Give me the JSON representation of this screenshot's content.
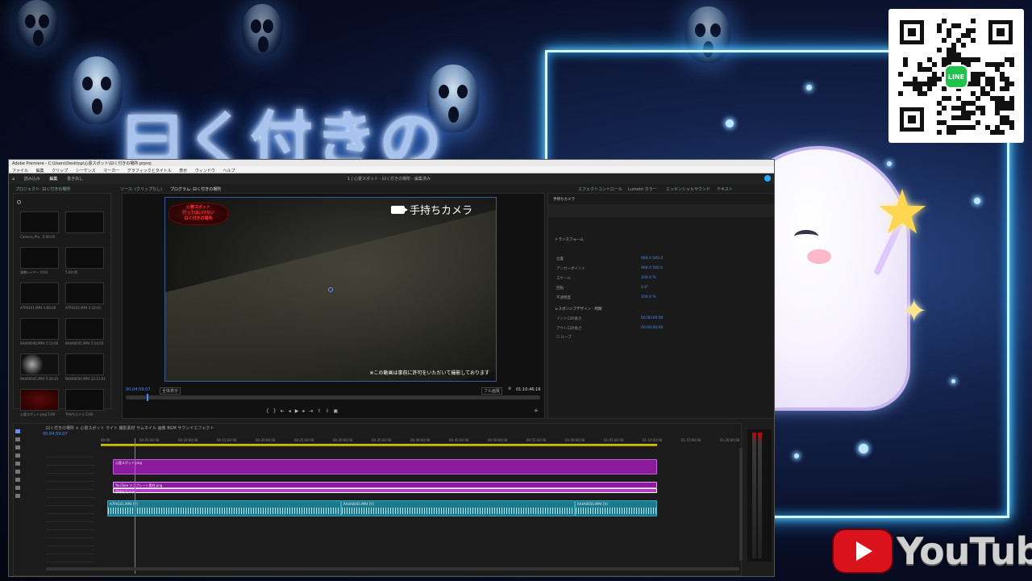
{
  "background": {
    "title": "曰く付きの",
    "accent": "#2aa9ff",
    "youtube_label": "YouTube",
    "line_label": "LINE"
  },
  "app": {
    "title": "Adobe Premiere - C:\\Users\\Desktop\\心霊スポット\\曰く付きの場所.prproj",
    "menu": [
      "ファイル",
      "編集",
      "クリップ",
      "シーケンス",
      "マーカー",
      "グラフィックとタイトル",
      "表示",
      "ウィンドウ",
      "ヘルプ"
    ],
    "workspace_tabs": [
      "読み込み",
      "編集",
      "書き出し"
    ],
    "center_title": "1 | 心霊スポット - 曰く付きの場所 - 編集済み",
    "project_tab": "プロジェクト: 曰く付きの場所",
    "source_tab": "ソース: (クリップなし)",
    "program_tab": "プログラム: 曰く付きの場所",
    "effects_tab": "エフェクトコントロール",
    "lumetri_tab": "Lumetri カラー",
    "essential_tab": "エッセンシャルサウンド",
    "text_tab": "テキスト"
  },
  "project": {
    "items": [
      {
        "label": "Camera_Pro..",
        "dur": "5:00:05"
      },
      {
        "label": "",
        "dur": ""
      },
      {
        "label": "調整レイヤー",
        "dur": "0:04"
      },
      {
        "label": "",
        "dur": "5:00:05"
      },
      {
        "label": "A7P4101.MP4",
        "dur": "5:00:00"
      },
      {
        "label": "A7P4102.MP4",
        "dur": "5:12:01"
      },
      {
        "label": "RA4A0040.MP4",
        "dur": "5:13:00"
      },
      {
        "label": "RA4A0041.MP4",
        "dur": "5:14:03"
      },
      {
        "label": "RA4A0045.MP4",
        "dur": "5:20:15"
      },
      {
        "label": "RA4A0050.MP4",
        "dur": "12:11:01"
      },
      {
        "label": "心霊スポット.png",
        "dur": "5:00"
      },
      {
        "label": "手持ちカメラ",
        "dur": "5:00"
      }
    ]
  },
  "monitor": {
    "camera_label": "手持ちカメラ",
    "stamp_lines": [
      "心霊スポット",
      "行ってはいけない",
      "曰く付きの場所"
    ],
    "notice": "※この動画は事前に許可をいただいて撮影しております",
    "current_time": "00:04:59:07",
    "fit": "全体表示",
    "quality": "フル画質",
    "duration": "01:10:46:16"
  },
  "effects": {
    "clip": "手持ちカメラ",
    "section_video": "ビデオ",
    "section_transform": "トランスフォーム",
    "props": [
      {
        "name": "位置",
        "value": "960.0    540.0"
      },
      {
        "name": "アンカーポイント",
        "value": "960.0    540.0"
      },
      {
        "name": "スケール",
        "value": "100.0 %"
      },
      {
        "name": "回転",
        "value": "0.0°"
      },
      {
        "name": "不透明度",
        "value": "100.0 %"
      }
    ],
    "section_responsive": "レスポンシブデザイン - 時間",
    "resp_props": [
      {
        "name": "イントロの長さ",
        "value": "00:00:00:00"
      },
      {
        "name": "アウトロの長さ",
        "value": "00:00:00:00"
      }
    ],
    "loop": "ループ"
  },
  "timeline": {
    "tabs": "曰く付きの場所 × 心霊スポット ライト 撮影素材 サムネイル 画像 BGM サウンドエフェクト",
    "timecode": "00:04:59:07",
    "ruler": [
      "00:00",
      "00:05:00:00",
      "00:10:00:00",
      "00:15:00:00",
      "00:20:00:00",
      "00:25:00:00",
      "00:30:00:00",
      "00:35:00:00",
      "00:40:00:00",
      "00:45:00:00",
      "00:50:00:00",
      "00:55:00:00",
      "01:00:00:00",
      "01:05:00:00",
      "01:10:00:00",
      "01:15:00:00",
      "01:20:00:00"
    ],
    "clips": [
      {
        "label": "心霊スポット.png"
      },
      {
        "label": "YouTube テンプレート素材.png"
      },
      {
        "label": "手持ちカメラ"
      },
      {
        "label": "調整レイヤー"
      },
      {
        "label": "A7P4101.MP4 [V]"
      },
      {
        "label": "RA4A0045.MP4 [V]"
      },
      {
        "label": "RA4A0050.MP4 [V]"
      }
    ]
  }
}
